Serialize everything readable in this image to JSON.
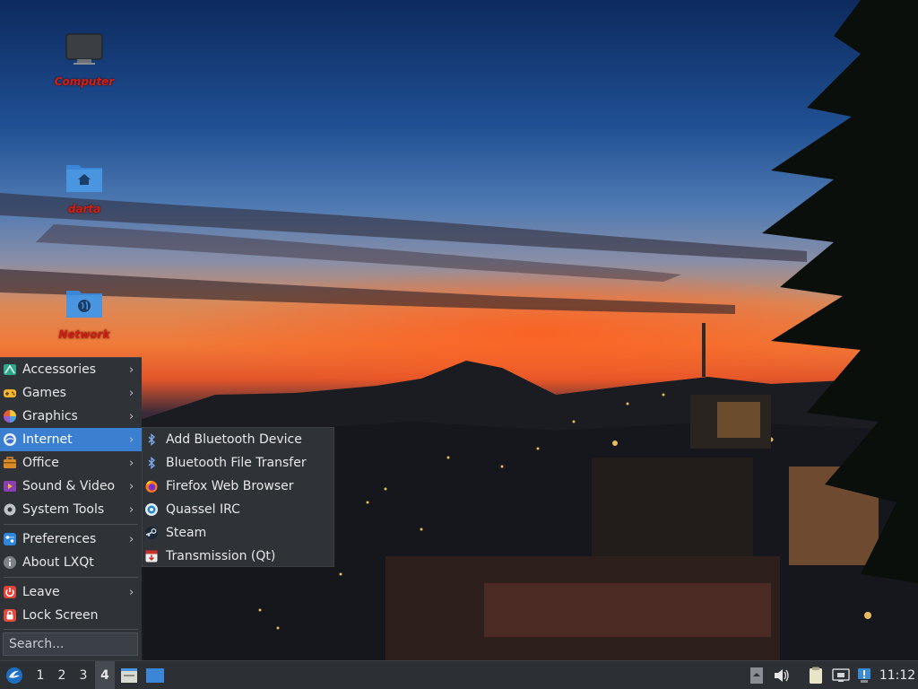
{
  "desktop": {
    "icons": [
      {
        "label": "Computer"
      },
      {
        "label": "darta"
      },
      {
        "label": "Network"
      }
    ]
  },
  "menu": {
    "items": [
      {
        "label": "Accessories",
        "icon": "accessories-icon",
        "submenu": true
      },
      {
        "label": "Games",
        "icon": "games-icon",
        "submenu": true
      },
      {
        "label": "Graphics",
        "icon": "graphics-icon",
        "submenu": true
      },
      {
        "label": "Internet",
        "icon": "internet-icon",
        "submenu": true,
        "active": true
      },
      {
        "label": "Office",
        "icon": "office-icon",
        "submenu": true
      },
      {
        "label": "Sound & Video",
        "icon": "sound-video-icon",
        "submenu": true
      },
      {
        "label": "System Tools",
        "icon": "system-tools-icon",
        "submenu": true
      },
      {
        "label": "Preferences",
        "icon": "preferences-icon",
        "submenu": true
      },
      {
        "label": "About LXQt",
        "icon": "info-icon",
        "submenu": false
      },
      {
        "label": "Leave",
        "icon": "power-icon",
        "submenu": true
      },
      {
        "label": "Lock Screen",
        "icon": "lock-icon",
        "submenu": false
      }
    ],
    "chevron": "›",
    "search_placeholder": "Search..."
  },
  "submenu": {
    "items": [
      {
        "label": "Add Bluetooth Device",
        "icon": "bluetooth-icon"
      },
      {
        "label": "Bluetooth File Transfer",
        "icon": "bluetooth-icon"
      },
      {
        "label": "Firefox Web Browser",
        "icon": "firefox-icon"
      },
      {
        "label": "Quassel IRC",
        "icon": "quassel-icon"
      },
      {
        "label": "Steam",
        "icon": "steam-icon"
      },
      {
        "label": "Transmission (Qt)",
        "icon": "transmission-icon"
      }
    ]
  },
  "taskbar": {
    "workspaces": [
      "1",
      "2",
      "3",
      "4"
    ],
    "current_workspace": "4",
    "clock": "11:12"
  },
  "colors": {
    "accent": "#3a7fd0",
    "menu_bg": "#2f3338",
    "icon_label": "#d21e10"
  }
}
